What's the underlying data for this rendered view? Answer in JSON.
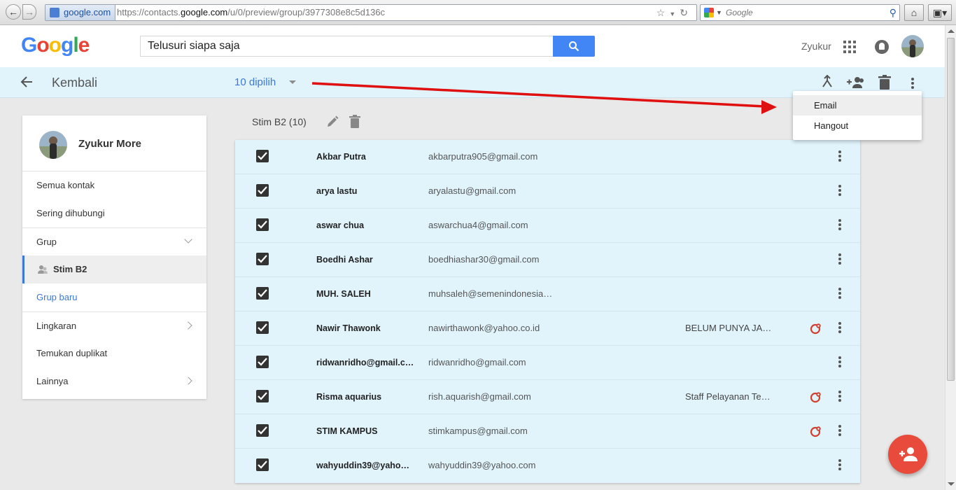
{
  "browser": {
    "site_label": "google.com",
    "url_prefix": "https://contacts.",
    "url_domain": "google.com",
    "url_suffix": "/u/0/preview/group/3977308e8c5d136c",
    "search_placeholder": "Google"
  },
  "header": {
    "logo_letters": [
      "G",
      "o",
      "o",
      "g",
      "l",
      "e"
    ],
    "logo_colors": [
      "#4285F4",
      "#EA4335",
      "#FBBC05",
      "#4285F4",
      "#34A853",
      "#EA4335"
    ],
    "search_value": "Telusuri siapa saja",
    "user_name": "Zyukur"
  },
  "action_bar": {
    "back_label": "Kembali",
    "selected_count_label": "10 dipilih"
  },
  "menu": {
    "items": [
      "Email",
      "Hangout"
    ]
  },
  "sidebar": {
    "profile_name": "Zyukur More",
    "items": [
      "Semua kontak",
      "Sering dihubungi",
      "Grup",
      "Stim B2",
      "Grup baru",
      "Lingkaran",
      "Temukan duplikat",
      "Lainnya"
    ]
  },
  "group": {
    "title": "Stim B2 (10)"
  },
  "contacts": [
    {
      "name": "Akbar Putra",
      "email": "akbarputra905@gmail.com",
      "job": "",
      "gplus": false
    },
    {
      "name": "arya lastu",
      "email": "aryalastu@gmail.com",
      "job": "",
      "gplus": false
    },
    {
      "name": "aswar chua",
      "email": "aswarchua4@gmail.com",
      "job": "",
      "gplus": false
    },
    {
      "name": "Boedhi Ashar",
      "email": "boedhiashar30@gmail.com",
      "job": "",
      "gplus": false
    },
    {
      "name": "MUH. SALEH",
      "email": "muhsaleh@semenindonesia…",
      "job": "",
      "gplus": false
    },
    {
      "name": "Nawir Thawonk",
      "email": "nawirthawonk@yahoo.co.id",
      "job": "BELUM PUNYA JAB…",
      "gplus": true
    },
    {
      "name": "ridwanridho@gmail.c…",
      "email": "ridwanridho@gmail.com",
      "job": "",
      "gplus": false
    },
    {
      "name": "Risma aquarius",
      "email": "rish.aquarish@gmail.com",
      "job": "Staff Pelayanan Tek…",
      "gplus": true
    },
    {
      "name": "STIM KAMPUS",
      "email": "stimkampus@gmail.com",
      "job": "",
      "gplus": true
    },
    {
      "name": "wahyuddin39@yahoo.…",
      "email": "wahyuddin39@yahoo.com",
      "job": "",
      "gplus": false
    }
  ],
  "colors": {
    "accent_blue": "#3B78D8",
    "selection_bg": "#E1F4FC",
    "fab_red": "#E84B3C",
    "annotation_red": "#E01010"
  }
}
